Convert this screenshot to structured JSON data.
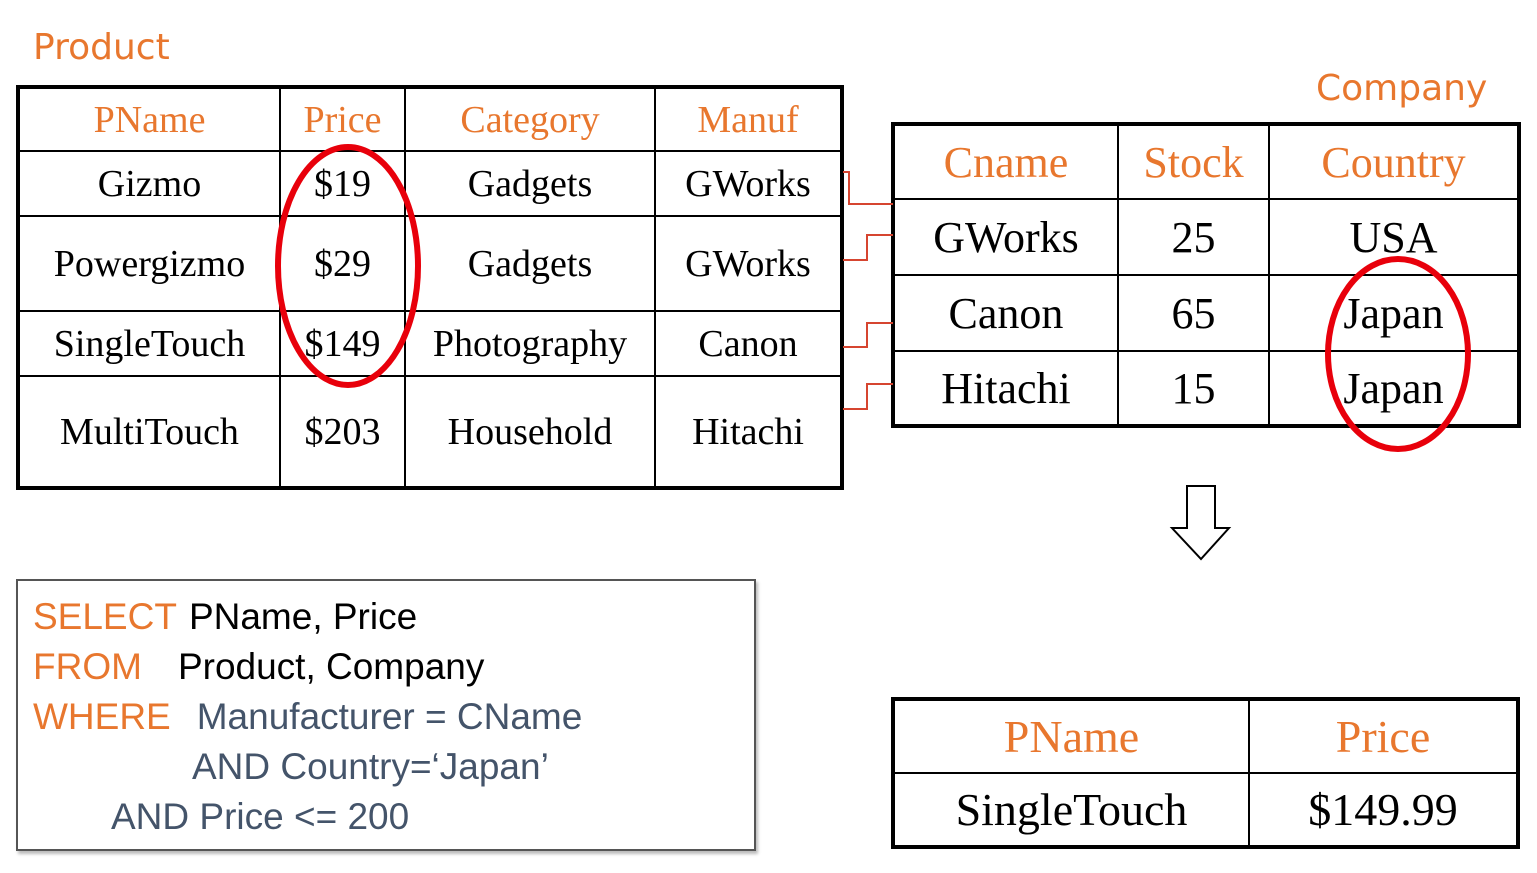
{
  "product": {
    "name": "Product",
    "columns": [
      "PName",
      "Price",
      "Category",
      "Manuf"
    ],
    "rows": [
      [
        "Gizmo",
        "$19",
        "Gadgets",
        "GWorks"
      ],
      [
        "Powergizmo",
        "$29",
        "Gadgets",
        "GWorks"
      ],
      [
        "SingleTouch",
        "$149",
        "Photography",
        "Canon"
      ],
      [
        "MultiTouch",
        "$203",
        "Household",
        "Hitachi"
      ]
    ]
  },
  "company": {
    "name": "Company",
    "columns": [
      "Cname",
      "Stock",
      "Country"
    ],
    "rows": [
      [
        "GWorks",
        "25",
        "USA"
      ],
      [
        "Canon",
        "65",
        "Japan"
      ],
      [
        "Hitachi",
        "15",
        "Japan"
      ]
    ]
  },
  "query": {
    "select_kw": "SELECT",
    "select_rest": "PName, Price",
    "from_kw": "FROM",
    "from_rest": "Product, Company",
    "where_kw": "WHERE",
    "where_cond": "Manufacturer = CName",
    "and_country": "AND Country=‘Japan’",
    "and_price": "AND Price <= 200"
  },
  "result": {
    "columns": [
      "PName",
      "Price"
    ],
    "rows": [
      [
        "SingleTouch",
        "$149.99"
      ]
    ]
  },
  "colors": {
    "label": "#E8772E",
    "highlight": "#E8000B",
    "link": "#D64530",
    "condition": "#44546A"
  }
}
